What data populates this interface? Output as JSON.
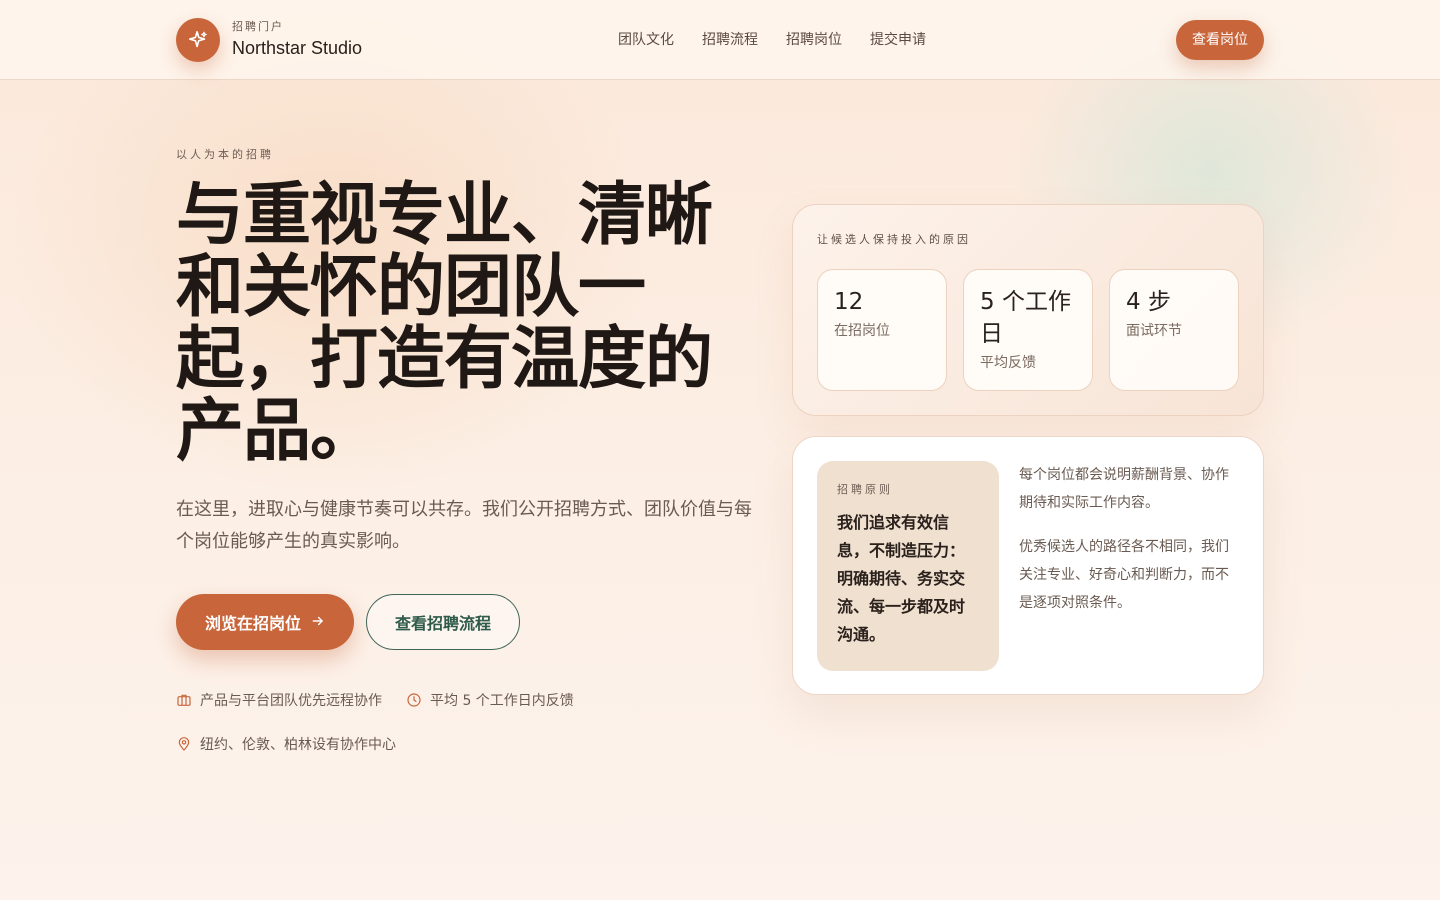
{
  "header": {
    "brand_eyebrow": "招聘门户",
    "brand_name": "Northstar Studio",
    "nav": [
      "团队文化",
      "招聘流程",
      "招聘岗位",
      "提交申请"
    ],
    "cta_label": "查看岗位"
  },
  "hero": {
    "eyebrow": "以人为本的招聘",
    "title": "与重视专业、清晰和关怀的团队一起，打造有温度的产品。",
    "subtitle": "在这里，进取心与健康节奏可以共存。我们公开招聘方式、团队价值与每个岗位能够产生的真实影响。",
    "primary_button": "浏览在招岗位",
    "primary_button_icon": "arrow-right-icon",
    "secondary_button": "查看招聘流程",
    "meta": [
      {
        "icon": "briefcase-icon",
        "text": "产品与平台团队优先远程协作"
      },
      {
        "icon": "clock-icon",
        "text": "平均 5 个工作日内反馈"
      },
      {
        "icon": "location-pin-icon",
        "text": "纽约、伦敦、柏林设有协作中心"
      }
    ]
  },
  "stats": {
    "title": "让候选人保持投入的原因",
    "items": [
      {
        "value": "12",
        "label": "在招岗位"
      },
      {
        "value": "5 个工作日",
        "label": "平均反馈"
      },
      {
        "value": "4 步",
        "label": "面试环节"
      }
    ]
  },
  "principle": {
    "eyebrow": "招聘原则",
    "quote": "我们追求有效信息，不制造压力：明确期待、务实交流、每一步都及时沟通。",
    "paragraphs": [
      "每个岗位都会说明薪酬背景、协作期待和实际工作内容。",
      "优秀候选人的路径各不相同，我们关注专业、好奇心和判断力，而不是逐项对照条件。"
    ]
  },
  "colors": {
    "accent": "#c8653a",
    "secondary": "#2f5b4b",
    "background": "#fcefe5",
    "text": "#1f1814"
  }
}
